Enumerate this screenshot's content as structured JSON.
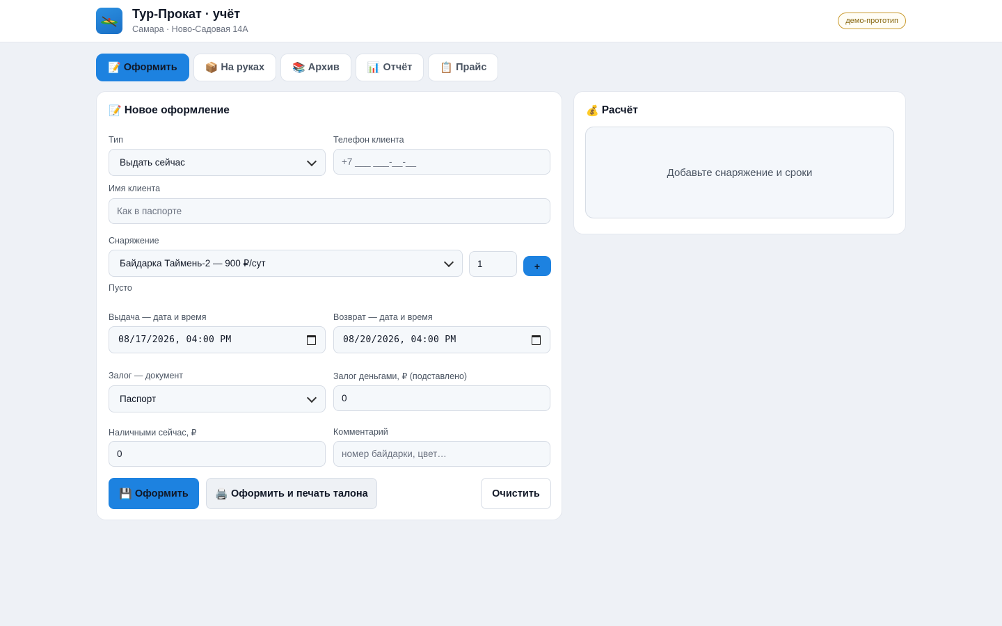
{
  "app": {
    "title": "Тур-Прокат · учёт",
    "subtitle": "Самара · Ново-Садовая 14А",
    "badge": "демо-прототип",
    "logo_icon": "kayak-icon"
  },
  "tabs": [
    {
      "icon": "📝",
      "label": "Оформить",
      "active": true
    },
    {
      "icon": "📦",
      "label": "На руках",
      "active": false
    },
    {
      "icon": "📚",
      "label": "Архив",
      "active": false
    },
    {
      "icon": "📊",
      "label": "Отчёт",
      "active": false
    },
    {
      "icon": "📋",
      "label": "Прайс",
      "active": false
    }
  ],
  "form": {
    "title_icon": "📝",
    "title": "Новое оформление",
    "type_label": "Тип",
    "type_value": "Выдать сейчас",
    "phone_label": "Телефон клиента",
    "phone_placeholder": "+7 ___ ___-__-__",
    "name_label": "Имя клиента",
    "name_placeholder": "Как в паспорте",
    "equipment_label": "Снаряжение",
    "equipment_value": "Байдарка Таймень-2 — 900 ₽/сут",
    "quantity_value": "1",
    "add_label": "+",
    "equipment_empty": "Пусто",
    "issue_label": "Выдача — дата и время",
    "issue_value": "08/17/2026, 04:00 PM",
    "return_label": "Возврат — дата и время",
    "return_value": "08/20/2026, 04:00 PM",
    "deposit_doc_label": "Залог — документ",
    "deposit_doc_value": "Паспорт",
    "deposit_money_label": "Залог деньгами, ₽ (подставлено)",
    "deposit_money_value": "0",
    "cash_label": "Наличными сейчас, ₽",
    "cash_value": "0",
    "comment_label": "Комментарий",
    "comment_placeholder": "номер байдарки, цвет…",
    "submit_icon": "💾",
    "submit_label": "Оформить",
    "print_icon": "🖨️",
    "print_label": "Оформить и печать талона",
    "clear_label": "Очистить"
  },
  "calc": {
    "title_icon": "💰",
    "title": "Расчёт",
    "empty_text": "Добавьте снаряжение и сроки"
  },
  "colors": {
    "accent": "#1d82e0",
    "background": "#eef1f6",
    "badge_border": "#c99a2e"
  }
}
